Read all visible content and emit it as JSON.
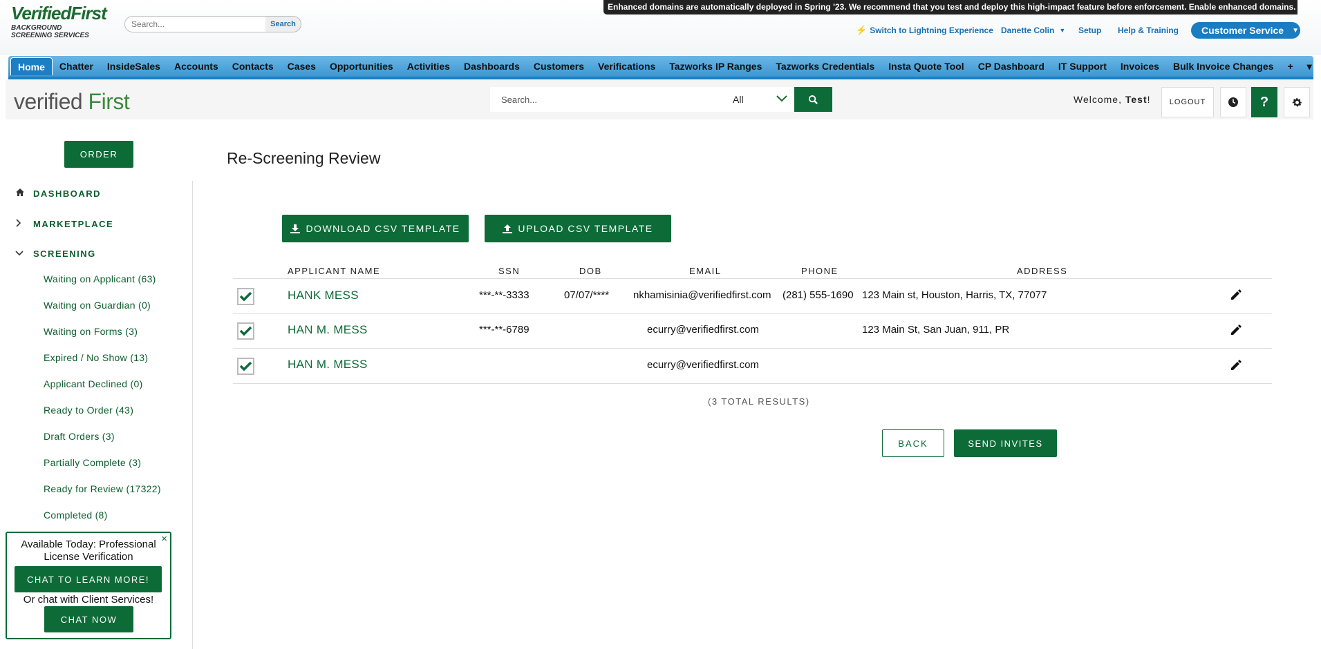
{
  "sf_header": {
    "logo_main": "VerifiedFirst",
    "logo_sub_1": "BACKGROUND",
    "logo_sub_2": "SCREENING SERVICES",
    "search_placeholder": "Search...",
    "search_button": "Search",
    "banner": "Enhanced domains are automatically deployed in Spring '23. We recommend that you test and deploy this high-impact feature before enforcement. Enable enhanced domains.",
    "lightning_link": "Switch to Lightning Experience",
    "user_menu": "Danette Colin",
    "setup_link": "Setup",
    "help_link": "Help & Training",
    "app_switcher": "Customer Service"
  },
  "sf_tabs": [
    "Home",
    "Chatter",
    "InsideSales",
    "Accounts",
    "Contacts",
    "Cases",
    "Opportunities",
    "Activities",
    "Dashboards",
    "Customers",
    "Verifications",
    "Tazworks IP Ranges",
    "Tazworks Credentials",
    "Insta Quote Tool",
    "CP Dashboard",
    "IT Support",
    "Invoices",
    "Bulk Invoice Changes"
  ],
  "sf_tab_extra": {
    "add": "+",
    "more": "▾"
  },
  "app_header": {
    "logo_part1": "verified",
    "logo_part2": " First",
    "search_placeholder": "Search...",
    "filter_value": "All",
    "welcome_prefix": "Welcome, ",
    "welcome_name": "Test",
    "welcome_suffix": "!",
    "logout": "LOGOUT",
    "help_glyph": "?"
  },
  "sidebar": {
    "order_button": "ORDER",
    "main_items": [
      {
        "label": "DASHBOARD",
        "icon": "home-icon"
      },
      {
        "label": "MARKETPLACE",
        "icon": "chevron-right-icon"
      },
      {
        "label": "SCREENING",
        "icon": "chevron-down-icon"
      }
    ],
    "sub_items": [
      "Waiting on Applicant (63)",
      "Waiting on Guardian (0)",
      "Waiting on Forms (3)",
      "Expired / No Show (13)",
      "Applicant Declined (0)",
      "Ready to Order (43)",
      "Draft Orders (3)",
      "Partially Complete (3)",
      "Ready for Review (17322)",
      "Completed (8)"
    ]
  },
  "main": {
    "title": "Re-Screening Review",
    "download_csv": "DOWNLOAD CSV TEMPLATE",
    "upload_csv": "UPLOAD CSV TEMPLATE",
    "columns": [
      "APPLICANT NAME",
      "SSN",
      "DOB",
      "EMAIL",
      "PHONE",
      "ADDRESS"
    ],
    "rows": [
      {
        "checked": true,
        "name": "HANK MESS",
        "ssn": "***-**-3333",
        "dob": "07/07/****",
        "email": "nkhamisinia@verifiedfirst.com",
        "phone": "(281) 555-1690",
        "address": "123 Main st, Houston, Harris, TX, 77077"
      },
      {
        "checked": true,
        "name": "HAN M. MESS",
        "ssn": "***-**-6789",
        "dob": "",
        "email": "ecurry@verifiedfirst.com",
        "phone": "",
        "address": "123 Main St, San Juan, 911, PR"
      },
      {
        "checked": true,
        "name": "HAN M. MESS",
        "ssn": "",
        "dob": "",
        "email": "ecurry@verifiedfirst.com",
        "phone": "",
        "address": ""
      }
    ],
    "total": "(3 TOTAL RESULTS)",
    "back": "BACK",
    "send_invites": "SEND INVITES"
  },
  "chat_popup": {
    "close": "×",
    "message_line1": "Available Today: Professional",
    "message_line2": "License Verification",
    "learn_button": "CHAT TO LEARN MORE!",
    "or_text": "Or chat with Client Services!",
    "chat_now": "CHAT NOW"
  },
  "colors": {
    "brand_green": "#0d6b38",
    "sf_tab_blue": "#3c97d2",
    "link_blue": "#1a6fb3"
  }
}
